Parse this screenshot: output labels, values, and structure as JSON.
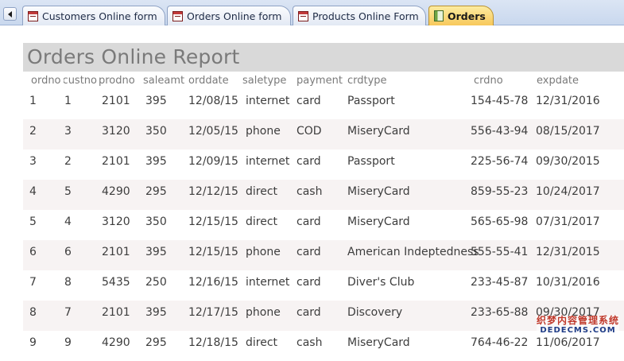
{
  "tabs": [
    {
      "label": "Customers Online form",
      "icon": "form-icon"
    },
    {
      "label": "Orders Online form",
      "icon": "form-icon"
    },
    {
      "label": "Products Online Form",
      "icon": "form-icon"
    },
    {
      "label": "Orders",
      "icon": "report-icon",
      "active": true
    }
  ],
  "report": {
    "title": "Orders Online Report",
    "columns": [
      "ordno",
      "custno",
      "prodno",
      "saleamt",
      "orddate",
      "saletype",
      "payment",
      "crdtype",
      "crdno",
      "expdate"
    ],
    "rows": [
      [
        "1",
        "1",
        "2101",
        "395",
        "12/08/15",
        "internet",
        "card",
        "Passport",
        "154-45-78",
        "12/31/2016"
      ],
      [
        "2",
        "3",
        "3120",
        "350",
        "12/05/15",
        "phone",
        "COD",
        "MiseryCard",
        "556-43-94",
        "08/15/2017"
      ],
      [
        "3",
        "2",
        "2101",
        "395",
        "12/09/15",
        "internet",
        "card",
        "Passport",
        "225-56-74",
        "09/30/2015"
      ],
      [
        "4",
        "5",
        "4290",
        "295",
        "12/12/15",
        "direct",
        "cash",
        "MiseryCard",
        "859-55-23",
        "10/24/2017"
      ],
      [
        "5",
        "4",
        "3120",
        "350",
        "12/15/15",
        "direct",
        "card",
        "MiseryCard",
        "565-65-98",
        "07/31/2017"
      ],
      [
        "6",
        "6",
        "2101",
        "395",
        "12/15/15",
        "phone",
        "card",
        "American Indeptedness",
        "555-55-41",
        "12/31/2015"
      ],
      [
        "7",
        "8",
        "5435",
        "250",
        "12/16/15",
        "internet",
        "card",
        "Diver's Club",
        "233-45-87",
        "10/31/2016"
      ],
      [
        "8",
        "7",
        "2101",
        "395",
        "12/17/15",
        "phone",
        "card",
        "Discovery",
        "233-65-88",
        "09/30/2017"
      ],
      [
        "9",
        "9",
        "4290",
        "295",
        "12/18/15",
        "direct",
        "cash",
        "MiseryCard",
        "764-46-22",
        "11/06/2017"
      ]
    ]
  },
  "watermark": {
    "line1": "织梦内容管理系统",
    "line2": "DEDECMS.COM"
  },
  "colors": {
    "active_tab": "#f7c85b",
    "title_band": "#d9d9d9",
    "alt_row": "#f7f3f3"
  }
}
